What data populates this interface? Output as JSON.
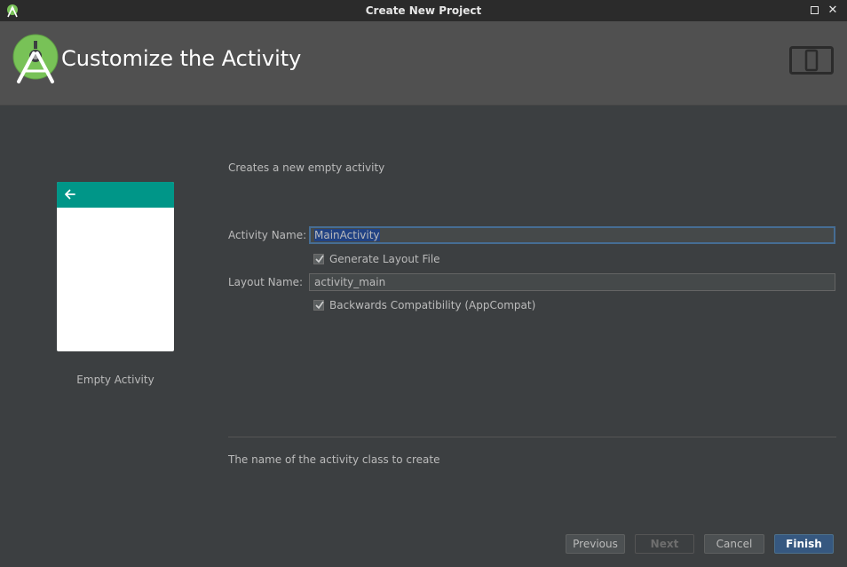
{
  "window": {
    "title": "Create New Project"
  },
  "header": {
    "title": "Customize the Activity"
  },
  "preview": {
    "template_name": "Empty Activity"
  },
  "form": {
    "description": "Creates a new empty activity",
    "activity_name_label": "Activity Name:",
    "activity_name_value": "MainActivity",
    "generate_layout_label": "Generate Layout File",
    "generate_layout_checked": true,
    "layout_name_label": "Layout Name:",
    "layout_name_value": "activity_main",
    "backwards_compat_label": "Backwards Compatibility (AppCompat)",
    "backwards_compat_checked": true,
    "hint": "The name of the activity class to create"
  },
  "buttons": {
    "previous": "Previous",
    "next": "Next",
    "cancel": "Cancel",
    "finish": "Finish"
  },
  "colors": {
    "background": "#3c3f41",
    "banner": "#505050",
    "appbar_teal": "#009688",
    "android_green": "#78c257",
    "selection": "#214283",
    "primary_button": "#365880"
  }
}
